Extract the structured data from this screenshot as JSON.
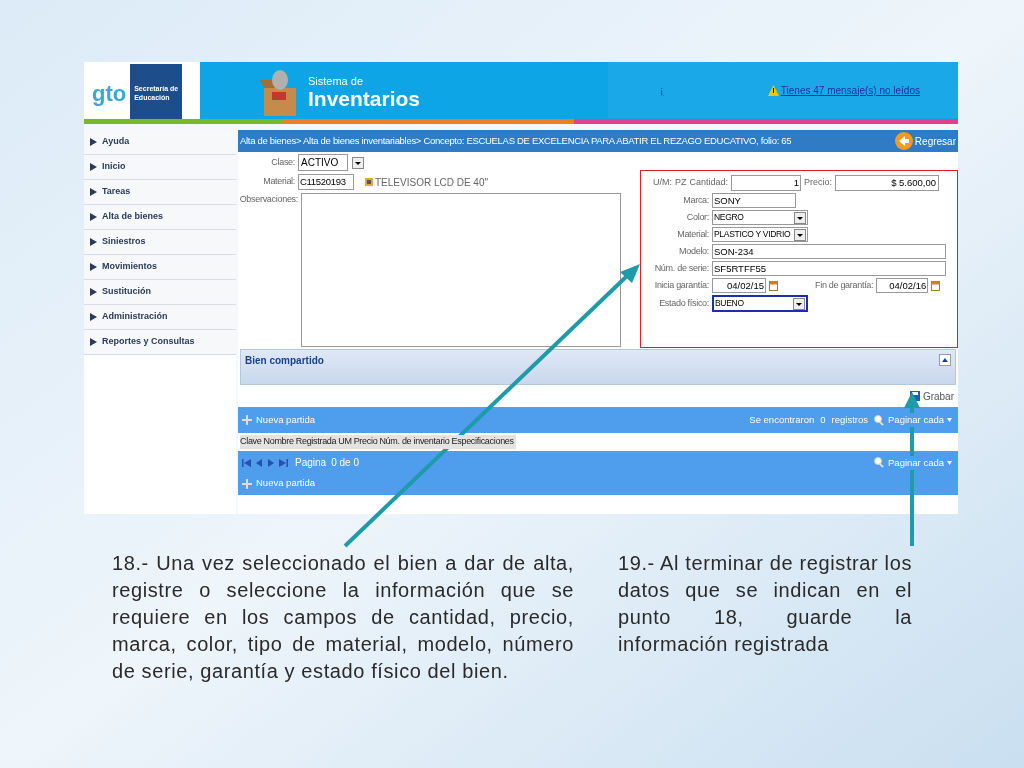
{
  "header": {
    "logo_text": "gto",
    "org_lines": [
      "Secretaría de",
      "Educación"
    ],
    "system_title": "Sistema de",
    "system_name": "Inventarios",
    "link": "¡",
    "messages": "Tienes 47 mensaje(s) no leídos"
  },
  "sidebar": {
    "items": [
      {
        "label": "Ayuda"
      },
      {
        "label": "Inicio"
      },
      {
        "label": "Tareas"
      },
      {
        "label": "Alta de bienes"
      },
      {
        "label": "Siniestros"
      },
      {
        "label": "Movimientos"
      },
      {
        "label": "Sustitución"
      },
      {
        "label": "Administración"
      },
      {
        "label": "Reportes y Consultas"
      }
    ]
  },
  "breadcrumb": "Alta de bienes> Alta de bienes inventariables> Concepto: ESCUELAS DE EXCELENCIA PARA ABATIR EL REZAGO EDUCATIVO, folio: 65",
  "back_button": "Regresar",
  "general": {
    "clase_label": "Clase:",
    "clase_value": "ACTIVO",
    "material_label": "Material:",
    "material_code": "C11520193",
    "material_description": "TELEVISOR LCD DE 40\"",
    "observaciones_label": "Observaciones:"
  },
  "details": {
    "highlighted": true,
    "um_label": "U/M:",
    "um_value": "PZ",
    "cantidad_label": "Cantidad:",
    "cantidad_value": "1",
    "precio_label": "Precio:",
    "precio_value": "$ 5.600,00",
    "fields": [
      {
        "kind": "text",
        "label": "Marca:",
        "value": "SONY",
        "focused": false
      },
      {
        "kind": "select",
        "label": "Color:",
        "value": "NEGRO",
        "focused": false
      },
      {
        "kind": "select",
        "label": "Material:",
        "value": "PLASTICO Y VIDRIO",
        "focused": false
      },
      {
        "kind": "wide",
        "label": "Modelo:",
        "value": "SON-234",
        "focused": false
      },
      {
        "kind": "wide",
        "label": "Núm. de serie:",
        "value": "SF5RTFF55",
        "focused": false
      },
      {
        "kind": "dates",
        "label": "Inicia garantía:",
        "value": "04/02/15",
        "end_label": "Fin de garantía:",
        "end_value": "04/02/16",
        "focused": false
      },
      {
        "kind": "select",
        "label": "Estado físico:",
        "value": "BUENO",
        "focused": true
      }
    ]
  },
  "shared_panel": {
    "title": "Bien compartido",
    "expanded": true
  },
  "save_button": "Grabar",
  "grid": {
    "new_item": "Nueva partida",
    "found_label": "Se encontraron",
    "found_count": "0",
    "found_unit": "registros",
    "paging": "Paginar cada",
    "columns": [
      "Clave",
      "Nombre",
      "Registrada",
      "UM",
      "Precio",
      "Núm. de inventario",
      "Especificaciones"
    ],
    "pager_label": "Pagina",
    "pager_value": "0 de 0",
    "pager_paging": "Paginar cada",
    "pager_new_item": "Nueva partida"
  },
  "instructions": [
    "18.- Una vez seleccionado el bien  a dar de alta, registre o seleccione la información que se requiere en los campos de cantidad, precio, marca, color, tipo de material, modelo, número de serie, garantía y estado físico del bien.",
    "19.- Al terminar de registrar los datos que se indican en el punto 18, guarde la información registrada"
  ]
}
